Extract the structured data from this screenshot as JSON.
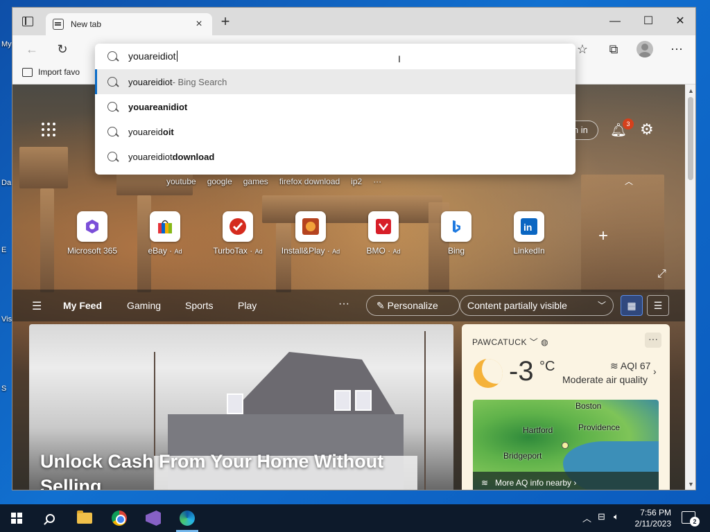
{
  "browser": {
    "tab_title": "New tab",
    "new_tab_symbol": "+",
    "close_symbol": "×",
    "favorites_bar": {
      "import_label": "Import favo"
    }
  },
  "omnibox": {
    "query": "youareidiot",
    "suggestions": [
      {
        "prefix": "youareidiot",
        "suffix": " - Bing Search",
        "bold": ""
      },
      {
        "prefix": "",
        "suffix": "",
        "bold": "youareanidiot"
      },
      {
        "prefix": "youareid",
        "suffix": "",
        "bold": "oit"
      },
      {
        "prefix": "youareidiot ",
        "suffix": "",
        "bold": "download"
      }
    ]
  },
  "newtab": {
    "signin_label": "Sign in",
    "notification_count": "3",
    "quick_searches": [
      "youtube",
      "google",
      "games",
      "firefox download",
      "ip2",
      "···"
    ],
    "tiles": [
      {
        "label": "Microsoft 365",
        "ad": ""
      },
      {
        "label": "eBay",
        "ad": "Ad"
      },
      {
        "label": "TurboTax",
        "ad": "Ad"
      },
      {
        "label": "Install&Play",
        "ad": "Ad"
      },
      {
        "label": "BMO",
        "ad": "Ad"
      },
      {
        "label": "Bing",
        "ad": ""
      },
      {
        "label": "LinkedIn",
        "ad": ""
      }
    ],
    "feed_tabs": [
      "My Feed",
      "Gaming",
      "Sports",
      "Play"
    ],
    "personalize_label": "Personalize",
    "visibility_label": "Content partially visible",
    "hero_title": "Unlock Cash From Your Home Without Selling"
  },
  "weather": {
    "location": "PAWCATUCK",
    "temperature": "-3",
    "unit": "°C",
    "aqi": "AQI 67",
    "quality": "Moderate air quality",
    "map_labels": {
      "boston": "Boston",
      "hartford": "Hartford",
      "providence": "Providence",
      "bridgeport": "Bridgeport"
    },
    "map_footer": "More AQ info nearby"
  },
  "taskbar": {
    "time": "7:56 PM",
    "date": "2/11/2023",
    "notification_count": "2"
  },
  "colors": {
    "accent": "#0a6cc8",
    "taskbar": "#0d1a2b",
    "badge": "#d5401c"
  }
}
